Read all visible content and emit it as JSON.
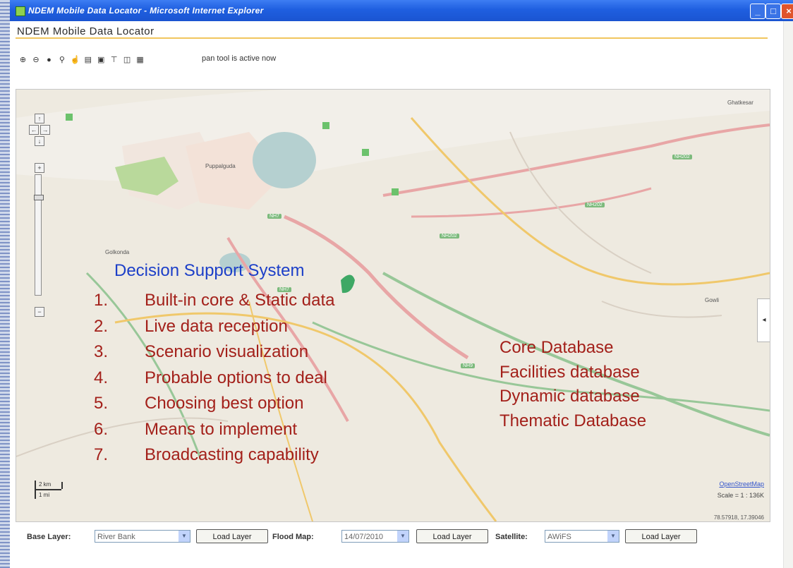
{
  "window": {
    "title": "NDEM Mobile Data Locator - Microsoft Internet Explorer"
  },
  "page": {
    "title": "NDEM Mobile Data Locator",
    "status": "pan tool is active now"
  },
  "toolbar": {
    "tools": [
      "zoom-in-icon",
      "zoom-out-icon",
      "info-icon",
      "search-icon",
      "pan-hand-icon",
      "layers-icon",
      "print-icon",
      "measure-icon",
      "extent-icon",
      "print-preview-icon"
    ]
  },
  "map": {
    "places": [
      "Puppalguda",
      "Golkonda",
      "Ghatkesar",
      "Gowli"
    ],
    "road_badges": [
      "NH7",
      "NH202",
      "NH202",
      "NH202",
      "NH9",
      "NH7"
    ],
    "scale_km": "2 km",
    "scale_mi": "1 mi",
    "attribution": "OpenStreetMap",
    "scale": "Scale = 1 : 136K",
    "coords": "78.57918, 17.39046"
  },
  "overlay": {
    "heading": "Decision Support System",
    "items": [
      {
        "num": "1.",
        "text": "Built-in core & Static data"
      },
      {
        "num": "2.",
        "text": "Live data reception"
      },
      {
        "num": "3.",
        "text": "Scenario visualization"
      },
      {
        "num": "4.",
        "text": "Probable options to deal"
      },
      {
        "num": "5.",
        "text": "Choosing best option"
      },
      {
        "num": "6.",
        "text": "Means to implement"
      },
      {
        "num": "7.",
        "text": "Broadcasting capability"
      }
    ],
    "databases": [
      "Core Database",
      "Facilities database",
      "Dynamic database",
      "Thematic Database"
    ]
  },
  "controls": {
    "base_layer_label": "Base Layer:",
    "base_layer_value": "River Bank",
    "flood_map_label": "Flood Map:",
    "flood_map_value": "14/07/2010",
    "satellite_label": "Satellite:",
    "satellite_value": "AWiFS",
    "load_label": "Load Layer"
  },
  "colors": {
    "titlebar": "#1f5fe0",
    "overlay_heading": "#1c3fc8",
    "overlay_text": "#a3201a",
    "rule": "#f1c65e"
  }
}
